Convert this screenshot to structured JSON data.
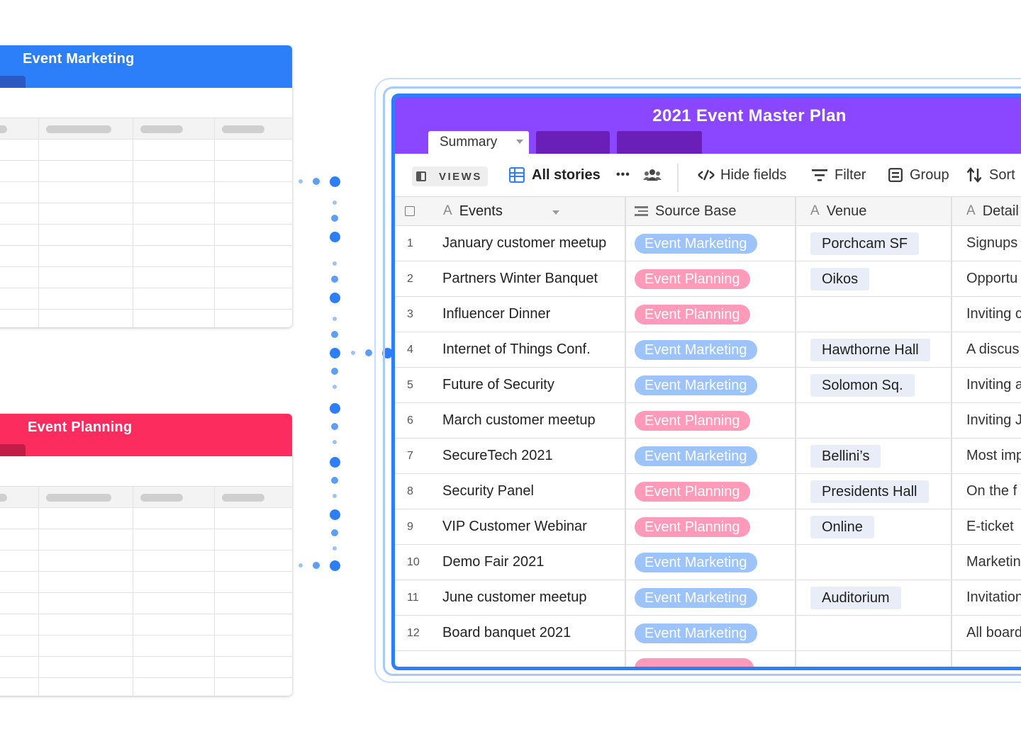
{
  "colors": {
    "marketing": "#2d7ff9",
    "marketing_tab": "#2b58c2",
    "planning": "#fc2c5e",
    "planning_tab": "#c21d47",
    "master_header": "#8b46ff",
    "tag_marketing": "#9cc3fa",
    "tag_planning": "#ff9aba"
  },
  "source_bases": [
    {
      "title": "Event Marketing"
    },
    {
      "title": "Event Planning"
    }
  ],
  "master": {
    "title": "2021 Event Master Plan",
    "active_tab": "Summary",
    "toolbar": {
      "views_label": "VIEWS",
      "view_name": "All stories",
      "more": "•••",
      "hide_fields": "Hide fields",
      "filter": "Filter",
      "group": "Group",
      "sort": "Sort"
    },
    "columns": {
      "events": "Events",
      "source": "Source Base",
      "venue": "Venue",
      "detail": "Detail"
    },
    "rows": [
      {
        "n": "1",
        "event": "January customer meetup",
        "source": "Event Marketing",
        "venue": "Porchcam SF",
        "detail": "Signups"
      },
      {
        "n": "2",
        "event": "Partners Winter Banquet",
        "source": "Event Planning",
        "venue": "Oikos",
        "detail": "Opportu"
      },
      {
        "n": "3",
        "event": "Influencer Dinner",
        "source": "Event Planning",
        "venue": "",
        "detail": "Inviting c"
      },
      {
        "n": "4",
        "event": "Internet of Things Conf.",
        "source": "Event Marketing",
        "venue": "Hawthorne Hall",
        "detail": "A discus"
      },
      {
        "n": "5",
        "event": "Future of Security",
        "source": "Event Marketing",
        "venue": "Solomon Sq.",
        "detail": "Inviting a"
      },
      {
        "n": "6",
        "event": "March customer meetup",
        "source": "Event Planning",
        "venue": "",
        "detail": "Inviting J"
      },
      {
        "n": "7",
        "event": "SecureTech 2021",
        "source": "Event Marketing",
        "venue": "Bellini’s",
        "detail": "Most imp"
      },
      {
        "n": "8",
        "event": "Security Panel",
        "source": "Event Planning",
        "venue": "Presidents Hall",
        "detail": "On the f"
      },
      {
        "n": "9",
        "event": "VIP Customer Webinar",
        "source": "Event Planning",
        "venue": "Online",
        "detail": "E-ticket"
      },
      {
        "n": "10",
        "event": "Demo Fair 2021",
        "source": "Event Marketing",
        "venue": "",
        "detail": "Marketin"
      },
      {
        "n": "11",
        "event": "June customer meetup",
        "source": "Event Marketing",
        "venue": "Auditorium",
        "detail": "Invitation"
      },
      {
        "n": "12",
        "event": "Board banquet 2021",
        "source": "Event Marketing",
        "venue": "",
        "detail": "All board"
      }
    ]
  }
}
